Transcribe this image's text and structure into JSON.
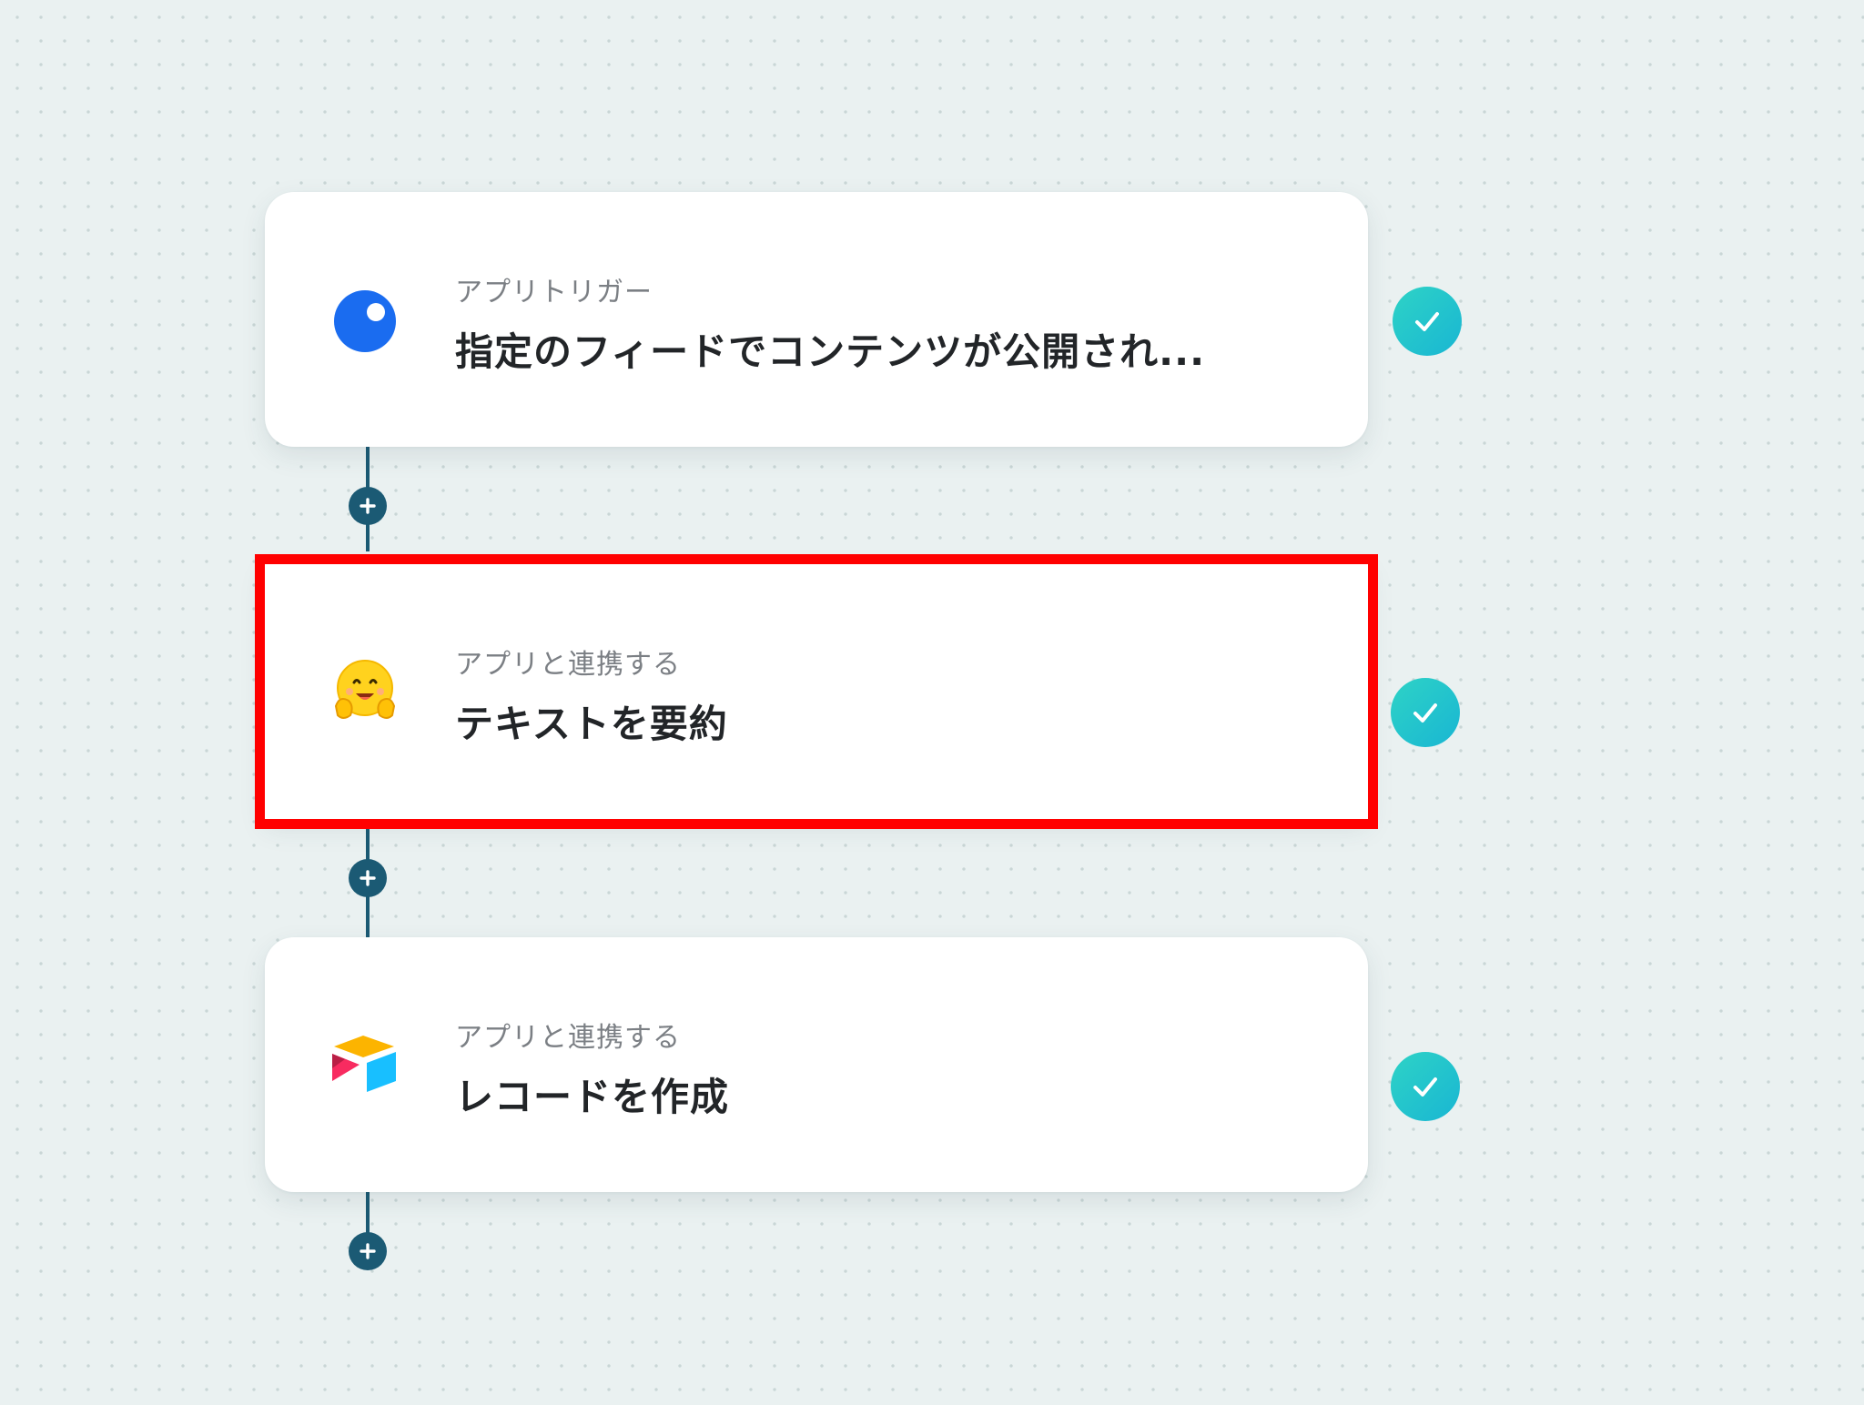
{
  "flow": {
    "steps": [
      {
        "label": "アプリトリガー",
        "title": "指定のフィードでコンテンツが公開され...",
        "icon": "blue-circle-app-icon",
        "status": "completed"
      },
      {
        "label": "アプリと連携する",
        "title": "テキストを要約",
        "icon": "hugging-face-icon",
        "status": "completed",
        "highlighted": true
      },
      {
        "label": "アプリと連携する",
        "title": "レコードを作成",
        "icon": "airtable-icon",
        "status": "completed"
      }
    ]
  },
  "colors": {
    "background": "#eaf1f1",
    "connector": "#1b5a74",
    "check_gradient_start": "#2ed3c6",
    "check_gradient_end": "#19b6d3",
    "highlight": "#ff0000"
  }
}
